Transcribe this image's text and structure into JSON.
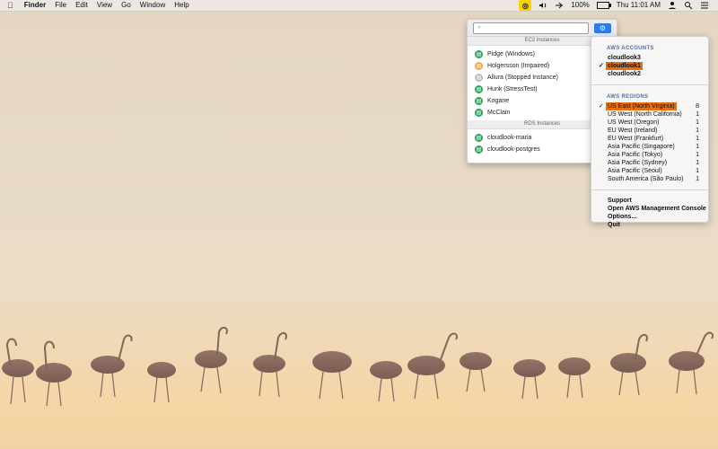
{
  "menubar": {
    "left_items": [
      "Finder",
      "File",
      "Edit",
      "View",
      "Go",
      "Window",
      "Help"
    ],
    "status": {
      "battery": "100%",
      "datetime": "Thu 11:01 AM"
    }
  },
  "popover": {
    "search": {
      "placeholder": ""
    },
    "ec2_header": "EC2 Instances",
    "ec2_instances": [
      {
        "label": "Pidge (Windows)",
        "status": "running",
        "color": "#2f9f5f"
      },
      {
        "label": "Holgersson (Impaired)",
        "status": "impaired",
        "color": "#f0a44d"
      },
      {
        "label": "Allura (Stopped Instance)",
        "status": "stopped",
        "color": "#bcbcbc"
      },
      {
        "label": "Hunk (StressTest)",
        "status": "running",
        "color": "#2f9f5f"
      },
      {
        "label": "Kogane",
        "status": "running",
        "color": "#2f9f5f"
      },
      {
        "label": "McClain",
        "status": "running",
        "color": "#2f9f5f"
      }
    ],
    "rds_header": "RDS Instances",
    "rds_instances": [
      {
        "label": "cloudlook-maria",
        "status": "running",
        "color": "#2f9f5f"
      },
      {
        "label": "cloudlook-postgres",
        "status": "running",
        "color": "#2f9f5f"
      }
    ]
  },
  "right_menu": {
    "accounts_title": "AWS ACCOUNTS",
    "accounts": [
      {
        "label": "cloudlook3",
        "checked": false,
        "highlighted": false
      },
      {
        "label": "cloudlook1",
        "checked": true,
        "highlighted": true
      },
      {
        "label": "cloudlook2",
        "checked": false,
        "highlighted": false
      }
    ],
    "regions_title": "AWS REGIONS",
    "regions": [
      {
        "label": "US East (North Virginia)",
        "count": "8",
        "checked": true,
        "highlighted": true
      },
      {
        "label": "US West (North California)",
        "count": "1",
        "checked": false,
        "highlighted": false
      },
      {
        "label": "US West (Oregon)",
        "count": "1",
        "checked": false,
        "highlighted": false
      },
      {
        "label": "EU West (Ireland)",
        "count": "1",
        "checked": false,
        "highlighted": false
      },
      {
        "label": "EU West (Frankfurt)",
        "count": "1",
        "checked": false,
        "highlighted": false
      },
      {
        "label": "Asia Pacific (Singapore)",
        "count": "1",
        "checked": false,
        "highlighted": false
      },
      {
        "label": "Asia Pacific (Tokyo)",
        "count": "1",
        "checked": false,
        "highlighted": false
      },
      {
        "label": "Asia Pacific (Sydney)",
        "count": "1",
        "checked": false,
        "highlighted": false
      },
      {
        "label": "Asia Pacific (Seoul)",
        "count": "1",
        "checked": false,
        "highlighted": false
      },
      {
        "label": "South America (São Paulo)",
        "count": "1",
        "checked": false,
        "highlighted": false
      }
    ],
    "actions": [
      "Support",
      "Open AWS Management Console",
      "Options...",
      "Quit"
    ]
  },
  "colors": {
    "accent_blue": "#2b7bf1",
    "menu_highlight": "#e4700f"
  }
}
